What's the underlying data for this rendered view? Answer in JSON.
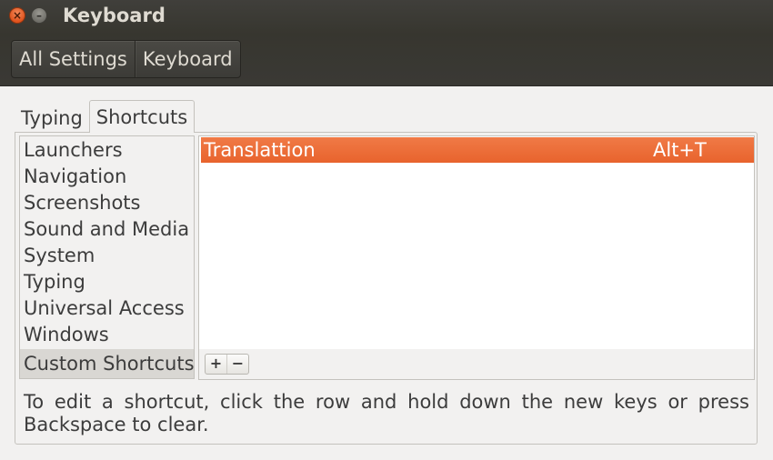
{
  "window": {
    "title": "Keyboard",
    "close_glyph": "×",
    "minimize_glyph": "–"
  },
  "breadcrumb": {
    "items": [
      {
        "label": "All Settings"
      },
      {
        "label": "Keyboard"
      }
    ]
  },
  "tabs": [
    {
      "label": "Typing",
      "active": false
    },
    {
      "label": "Shortcuts",
      "active": true
    }
  ],
  "categories": [
    {
      "label": "Launchers"
    },
    {
      "label": "Navigation"
    },
    {
      "label": "Screenshots"
    },
    {
      "label": "Sound and Media"
    },
    {
      "label": "System"
    },
    {
      "label": "Typing"
    },
    {
      "label": "Universal Access"
    },
    {
      "label": "Windows"
    },
    {
      "label": "Custom Shortcuts",
      "selected": true
    }
  ],
  "shortcuts": [
    {
      "name": "Translattion",
      "accelerator": "Alt+T",
      "selected": true
    }
  ],
  "list_toolbar": {
    "add_label": "+",
    "remove_label": "−"
  },
  "hint": "To edit a shortcut, click the row and hold down the new keys or press Backspace to clear.",
  "colors": {
    "accent": "#e8632d",
    "header": "#3c3b37"
  }
}
